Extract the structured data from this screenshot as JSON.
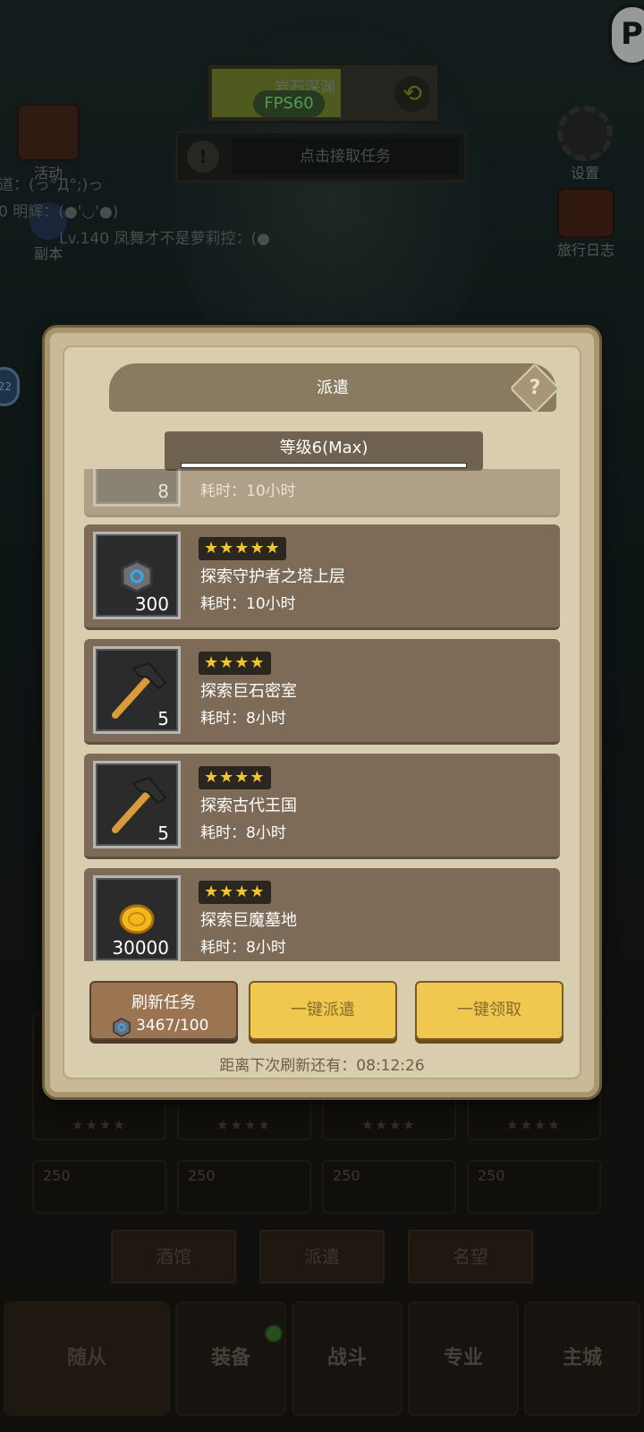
{
  "hud": {
    "location": "岩石深渊",
    "fps": "FPS60",
    "task_prompt": "点击接取任务",
    "activity": "活动",
    "dungeon": "副本",
    "settings": "设置",
    "travel_log": "旅行日志",
    "chat_lines": [
      "道：(っ°Д°;)っ",
      "0 明辉：(●'◡'●)",
      "Lv.140 凤舞才不是萝莉控：(●"
    ],
    "top_right_glyph": "P",
    "left_badge": "22"
  },
  "background_cards": {
    "level": "250",
    "stars": "★★★★"
  },
  "background_tabs": [
    "酒馆",
    "派遣",
    "名望"
  ],
  "bottom_nav": [
    "随从",
    "装备",
    "战斗",
    "专业",
    "主城"
  ],
  "panel": {
    "title": "派遣",
    "help_symbol": "?",
    "level": "等级6(Max)",
    "level_progress": 1.0,
    "partial_row": {
      "count": "8",
      "time": "耗时：10小时"
    },
    "missions": [
      {
        "stars": "★★★★★",
        "name": "探索守护者之塔上层",
        "time": "耗时：10小时",
        "count": "300",
        "icon": "stone-icon"
      },
      {
        "stars": "★★★★",
        "name": "探索巨石密室",
        "time": "耗时：8小时",
        "count": "5",
        "icon": "hammer-icon"
      },
      {
        "stars": "★★★★",
        "name": "探索古代王国",
        "time": "耗时：8小时",
        "count": "5",
        "icon": "hammer-icon"
      },
      {
        "stars": "★★★★",
        "name": "探索巨魔墓地",
        "time": "耗时：8小时",
        "count": "30000",
        "icon": "gold-coin-icon"
      }
    ],
    "refresh_label": "刷新任务",
    "refresh_cost": "3467/100",
    "dispatch_all": "一键派遣",
    "claim_all": "一键领取",
    "countdown": "距离下次刷新还有：08:12:26"
  },
  "colors": {
    "star": "#f2c531",
    "panel": "#d9cdb0",
    "row": "#7d6b57",
    "yellow_button": "#f0c850"
  }
}
